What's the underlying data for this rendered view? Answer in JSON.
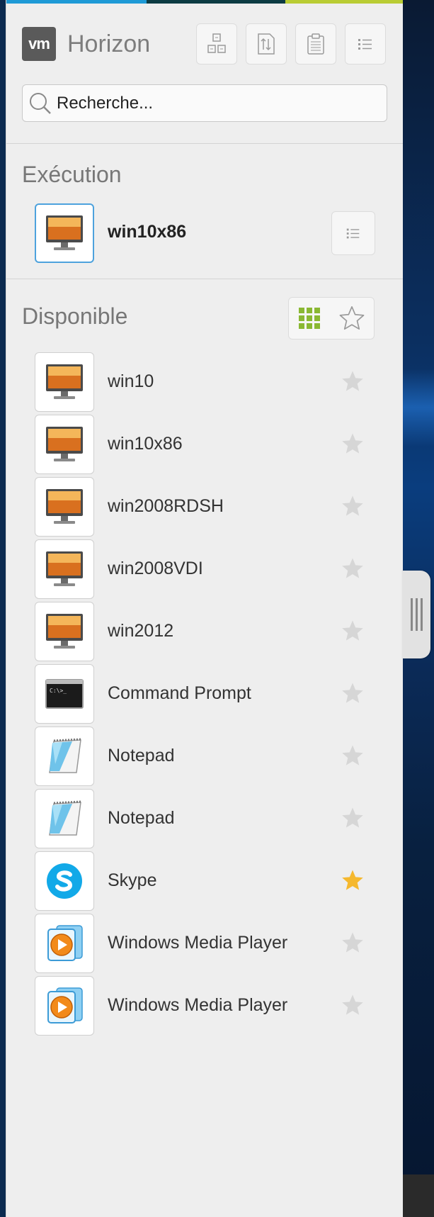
{
  "app": {
    "logo_text": "vm",
    "brand": "Horizon"
  },
  "toolbar": {
    "buttons": [
      {
        "name": "remote-desktop-button",
        "icon": "windows-grid-icon"
      },
      {
        "name": "transfer-button",
        "icon": "file-transfer-icon"
      },
      {
        "name": "clipboard-button",
        "icon": "clipboard-icon"
      },
      {
        "name": "menu-button",
        "icon": "list-menu-icon"
      }
    ]
  },
  "search": {
    "placeholder": "Recherche..."
  },
  "running": {
    "title": "Exécution",
    "items": [
      {
        "label": "win10x86",
        "icon": "desktop-icon"
      }
    ]
  },
  "available": {
    "title": "Disponible",
    "items": [
      {
        "label": "win10",
        "icon": "desktop-icon",
        "favorite": false
      },
      {
        "label": "win10x86",
        "icon": "desktop-icon",
        "favorite": false
      },
      {
        "label": "win2008RDSH",
        "icon": "desktop-icon",
        "favorite": false
      },
      {
        "label": "win2008VDI",
        "icon": "desktop-icon",
        "favorite": false
      },
      {
        "label": "win2012",
        "icon": "desktop-icon",
        "favorite": false
      },
      {
        "label": "Command Prompt",
        "icon": "command-prompt-icon",
        "favorite": false
      },
      {
        "label": "Notepad",
        "icon": "notepad-icon",
        "favorite": false
      },
      {
        "label": "Notepad",
        "icon": "notepad-icon",
        "favorite": false
      },
      {
        "label": "Skype",
        "icon": "skype-icon",
        "favorite": true
      },
      {
        "label": "Windows Media Player",
        "icon": "media-player-icon",
        "favorite": false
      },
      {
        "label": "Windows Media Player",
        "icon": "media-player-icon",
        "favorite": false
      }
    ]
  },
  "colors": {
    "accent_blue": "#1e9ad6",
    "accent_dark": "#0c3b43",
    "accent_green": "#b9cc33",
    "favorite_star": "#f5b82e",
    "inactive_star": "#d6d6d6",
    "grid_green": "#8ab833"
  }
}
